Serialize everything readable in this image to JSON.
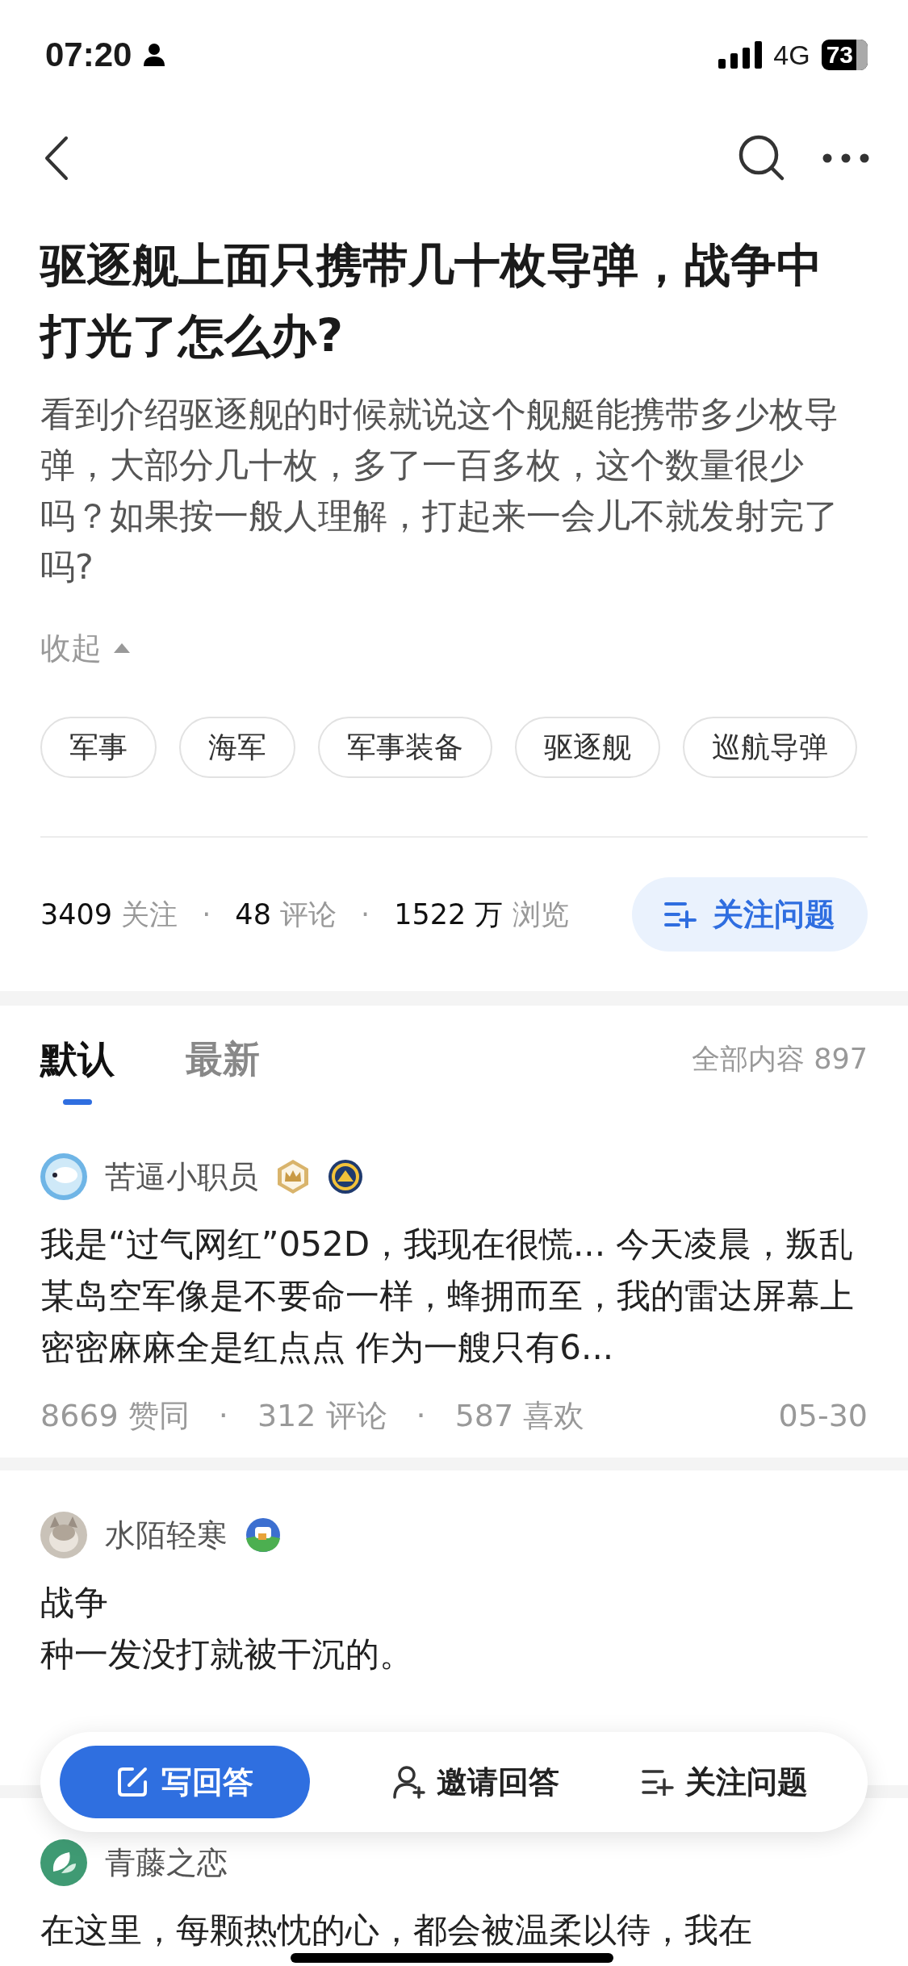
{
  "status_bar": {
    "time": "07:20",
    "network": "4G",
    "battery": "73"
  },
  "question": {
    "title": "驱逐舰上面只携带几十枚导弹，战争中打光了怎么办?",
    "description": "看到介绍驱逐舰的时候就说这个舰艇能携带多少枚导弹，大部分几十枚，多了一百多枚，这个数量很少吗？如果按一般人理解，打起来一会儿不就发射完了吗?",
    "collapse": "收起",
    "topics": [
      "军事",
      "海军",
      "军事装备",
      "驱逐舰",
      "巡航导弹"
    ],
    "separator": "·",
    "stats": [
      {
        "value": "3409",
        "label": "关注"
      },
      {
        "value": "48",
        "label": "评论"
      },
      {
        "value": "1522 万",
        "label": "浏览"
      }
    ],
    "follow_button": "关注问题"
  },
  "tabs": [
    {
      "label": "默认",
      "selected": true
    },
    {
      "label": "最新",
      "selected": false
    }
  ],
  "total": "全部内容 897",
  "answers": [
    {
      "author": "苦逼小职员",
      "badges": [
        {
          "kind": "crown"
        },
        {
          "kind": "emblem"
        }
      ],
      "lines": [
        "我是“过气网红”052D，我现在很慌... 今天凌晨，叛乱某岛空军像是不要命一样，蜂拥而至，我的雷达屏幕上密密麻麻全是红点点 作为一艘只有6..."
      ],
      "separator": "·",
      "stats": [
        {
          "value": "8669",
          "label": "赞同"
        },
        {
          "value": "312",
          "label": "评论"
        },
        {
          "value": "587",
          "label": "喜欢"
        }
      ],
      "date": "05-30"
    },
    {
      "author": "水陌轻寒",
      "badges": [
        {
          "kind": "mascot"
        }
      ],
      "lines": [
        "战争",
        "种一发没打就被干沉的。"
      ]
    },
    {
      "author": "青藤之恋",
      "lines": [
        "在这里，每颗热忱的心，都会被温柔以待，我在"
      ]
    }
  ],
  "bottom_bar": {
    "write": "写回答",
    "invite": "邀请回答",
    "follow": "关注问题"
  }
}
